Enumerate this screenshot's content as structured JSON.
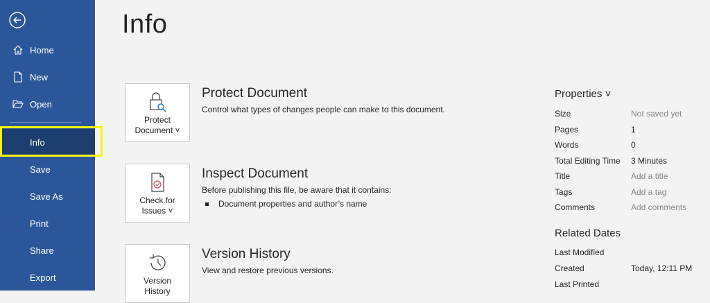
{
  "sidebar": {
    "items": [
      {
        "label": "Home"
      },
      {
        "label": "New"
      },
      {
        "label": "Open"
      },
      {
        "label": "Info"
      },
      {
        "label": "Save"
      },
      {
        "label": "Save As"
      },
      {
        "label": "Print"
      },
      {
        "label": "Share"
      },
      {
        "label": "Export"
      }
    ]
  },
  "main": {
    "title": "Info",
    "protect": {
      "card_line1": "Protect",
      "card_line2": "Document ˅",
      "title": "Protect Document",
      "desc": "Control what types of changes people can make to this document."
    },
    "inspect": {
      "card_line1": "Check for",
      "card_line2": "Issues ˅",
      "title": "Inspect Document",
      "desc": "Before publishing this file, be aware that it contains:",
      "bullet": "Document properties and author’s name"
    },
    "version": {
      "card_line1": "Version",
      "card_line2": "History",
      "title": "Version History",
      "desc": "View and restore previous versions."
    }
  },
  "properties": {
    "title": "Properties ˅",
    "rows": [
      {
        "key": "Size",
        "value": "Not saved yet"
      },
      {
        "key": "Pages",
        "value": "1"
      },
      {
        "key": "Words",
        "value": "0"
      },
      {
        "key": "Total Editing Time",
        "value": "3 Minutes"
      },
      {
        "key": "Title",
        "value": "Add a title"
      },
      {
        "key": "Tags",
        "value": "Add a tag"
      },
      {
        "key": "Comments",
        "value": "Add comments"
      }
    ]
  },
  "related_dates": {
    "title": "Related Dates",
    "rows": [
      {
        "key": "Last Modified",
        "value": ""
      },
      {
        "key": "Created",
        "value": "Today, 12:11 PM"
      },
      {
        "key": "Last Printed",
        "value": ""
      }
    ]
  },
  "colors": {
    "sidebar": "#2b579a",
    "selected": "#1d3e6e",
    "highlight": "#f5f50a"
  }
}
